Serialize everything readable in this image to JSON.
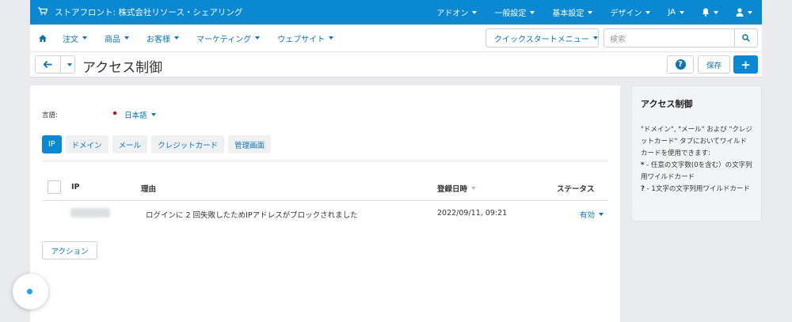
{
  "topbar": {
    "store_name": "ストアフロント: 株式会社リソース・シェアリング",
    "menu": [
      "アドオン",
      "一般設定",
      "基本設定",
      "デザイン",
      "JA"
    ]
  },
  "navbar": {
    "items": [
      "注文",
      "商品",
      "お客様",
      "マーケティング",
      "ウェブサイト"
    ],
    "quickstart_label": "クイックスタートメニュー",
    "search_placeholder": "検索"
  },
  "titlebar": {
    "title": "アクセス制御",
    "save_label": "保存",
    "help_symbol": "?",
    "plus_symbol": "+"
  },
  "main": {
    "language_label": "言語:",
    "language_value": "日本語",
    "tabs": [
      "IP",
      "ドメイン",
      "メール",
      "クレジットカード",
      "管理画面"
    ],
    "active_tab": "IP",
    "table": {
      "headers": [
        "IP",
        "理由",
        "登録日時",
        "ステータス"
      ],
      "rows": [
        {
          "reason": "ログインに 2 回失敗したためIPアドレスがブロックされました",
          "date": "2022/09/11, 09:21",
          "status": "有効"
        }
      ]
    },
    "action_label": "アクション"
  },
  "sidebar": {
    "title": "アクセス制御",
    "line1": "\"ドメイン\", \"メール\" および \"クレジットカード\" タブにおいてワイルドカードを使用できます:",
    "star_symbol": "*",
    "star_text": " - 任意の文字数(0を含む）の文字列用ワイルドカード",
    "q_symbol": "?",
    "q_text": " - 1文字の文字列用ワイルドカード"
  },
  "colors": {
    "brand_blue": "#0a88d1",
    "link_blue": "#0a74b7",
    "background": "#e9ebee"
  }
}
